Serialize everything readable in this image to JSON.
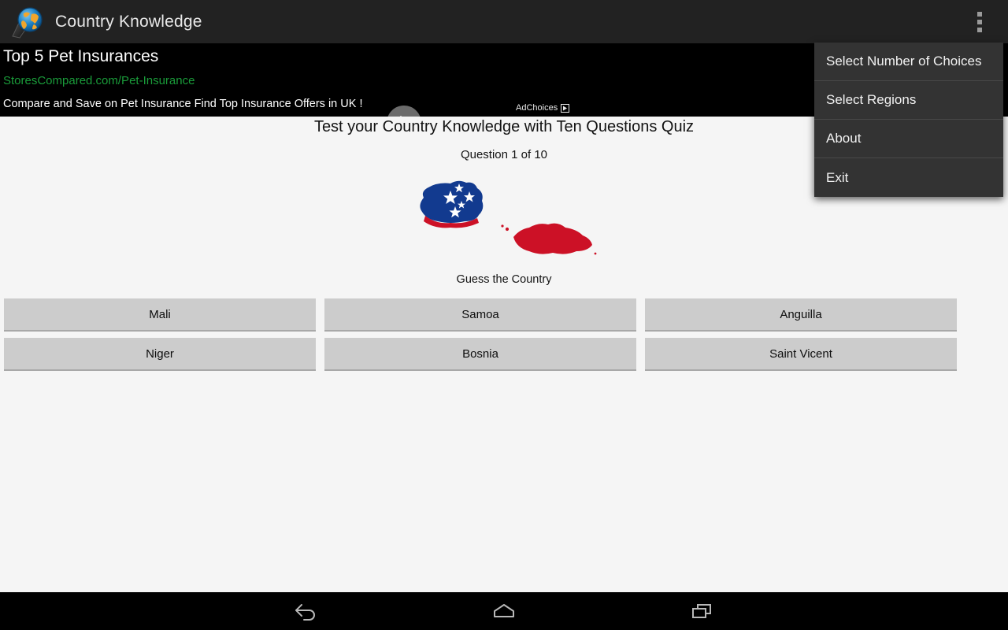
{
  "app": {
    "title": "Country Knowledge",
    "icon": "globe-icon"
  },
  "ad": {
    "headline": "Top 5 Pet Insurances",
    "url": "StoresCompared.com/Pet-Insurance",
    "description": "Compare and Save on Pet Insurance Find Top Insurance Offers in UK !",
    "adchoices_label": "AdChoices",
    "arrow_icon": "chevron-right-icon",
    "url_color": "#1a9c3a",
    "background_color": "#000000"
  },
  "menu": {
    "trigger_icon": "overflow-menu-icon",
    "items": [
      {
        "label": "Select Number of Choices"
      },
      {
        "label": "Select Regions"
      },
      {
        "label": "About"
      },
      {
        "label": "Exit"
      }
    ]
  },
  "quiz": {
    "title": "Test your Country Knowledge with Ten Questions Quiz",
    "question_counter": "Question 1 of 10",
    "prompt": "Guess the Country",
    "current_question": 1,
    "total_questions": 10,
    "map_image": {
      "name": "samoa-flag-map",
      "description": "Samoa islands shaped map filled with flag colors",
      "blue": "#123a8f",
      "red": "#cc1126",
      "star_color": "#ffffff",
      "star_count": 5
    },
    "answers": [
      {
        "label": "Mali"
      },
      {
        "label": "Samoa"
      },
      {
        "label": "Anguilla"
      },
      {
        "label": "Niger"
      },
      {
        "label": "Bosnia"
      },
      {
        "label": "Saint Vicent"
      }
    ],
    "button_color": "#cccccc",
    "background_color": "#f5f5f5"
  },
  "navbar": {
    "back_icon": "back-arrow-icon",
    "home_icon": "home-icon",
    "recents_icon": "recents-icon"
  }
}
